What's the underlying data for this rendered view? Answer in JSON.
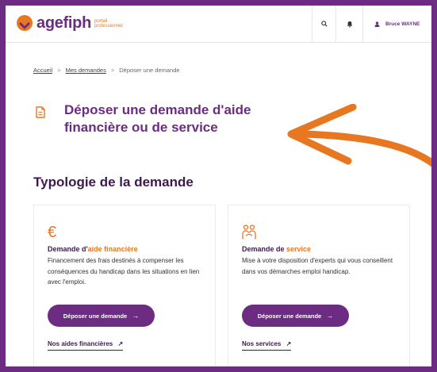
{
  "header": {
    "logo_text": "agefiph",
    "logo_sub_1": "portail",
    "logo_sub_2": "professionnel",
    "user_name": "Bruce WAYNE"
  },
  "breadcrumb": {
    "items": [
      "Accueil",
      "Mes demandes",
      "Déposer une demande"
    ],
    "separator": ">"
  },
  "page": {
    "title_line1": "Déposer une demande d'aide",
    "title_line2": "financière ou de service",
    "section_title": "Typologie de la demande"
  },
  "cards": [
    {
      "icon": "€",
      "title_prefix": "Demande d'",
      "title_accent": "aide financière",
      "description": "Financement des frais destinés à compenser les conséquences du handicap dans les situations en lien avec l'emploi.",
      "cta_label": "Déposer une demande",
      "cta_arrow": "→",
      "link_label": "Nos aides financières",
      "link_arrow": "↗"
    },
    {
      "icon": "people-icon",
      "title_prefix": "Demande de ",
      "title_accent": "service",
      "description": "Mise à votre disposition d'experts qui vous conseillent dans vos démarches emploi handicap.",
      "cta_label": "Déposer une demande",
      "cta_arrow": "→",
      "link_label": "Nos services",
      "link_arrow": "↗"
    }
  ],
  "colors": {
    "brand_purple": "#6b2c82",
    "accent_orange": "#e87722",
    "dark_text": "#3d1a4e"
  }
}
